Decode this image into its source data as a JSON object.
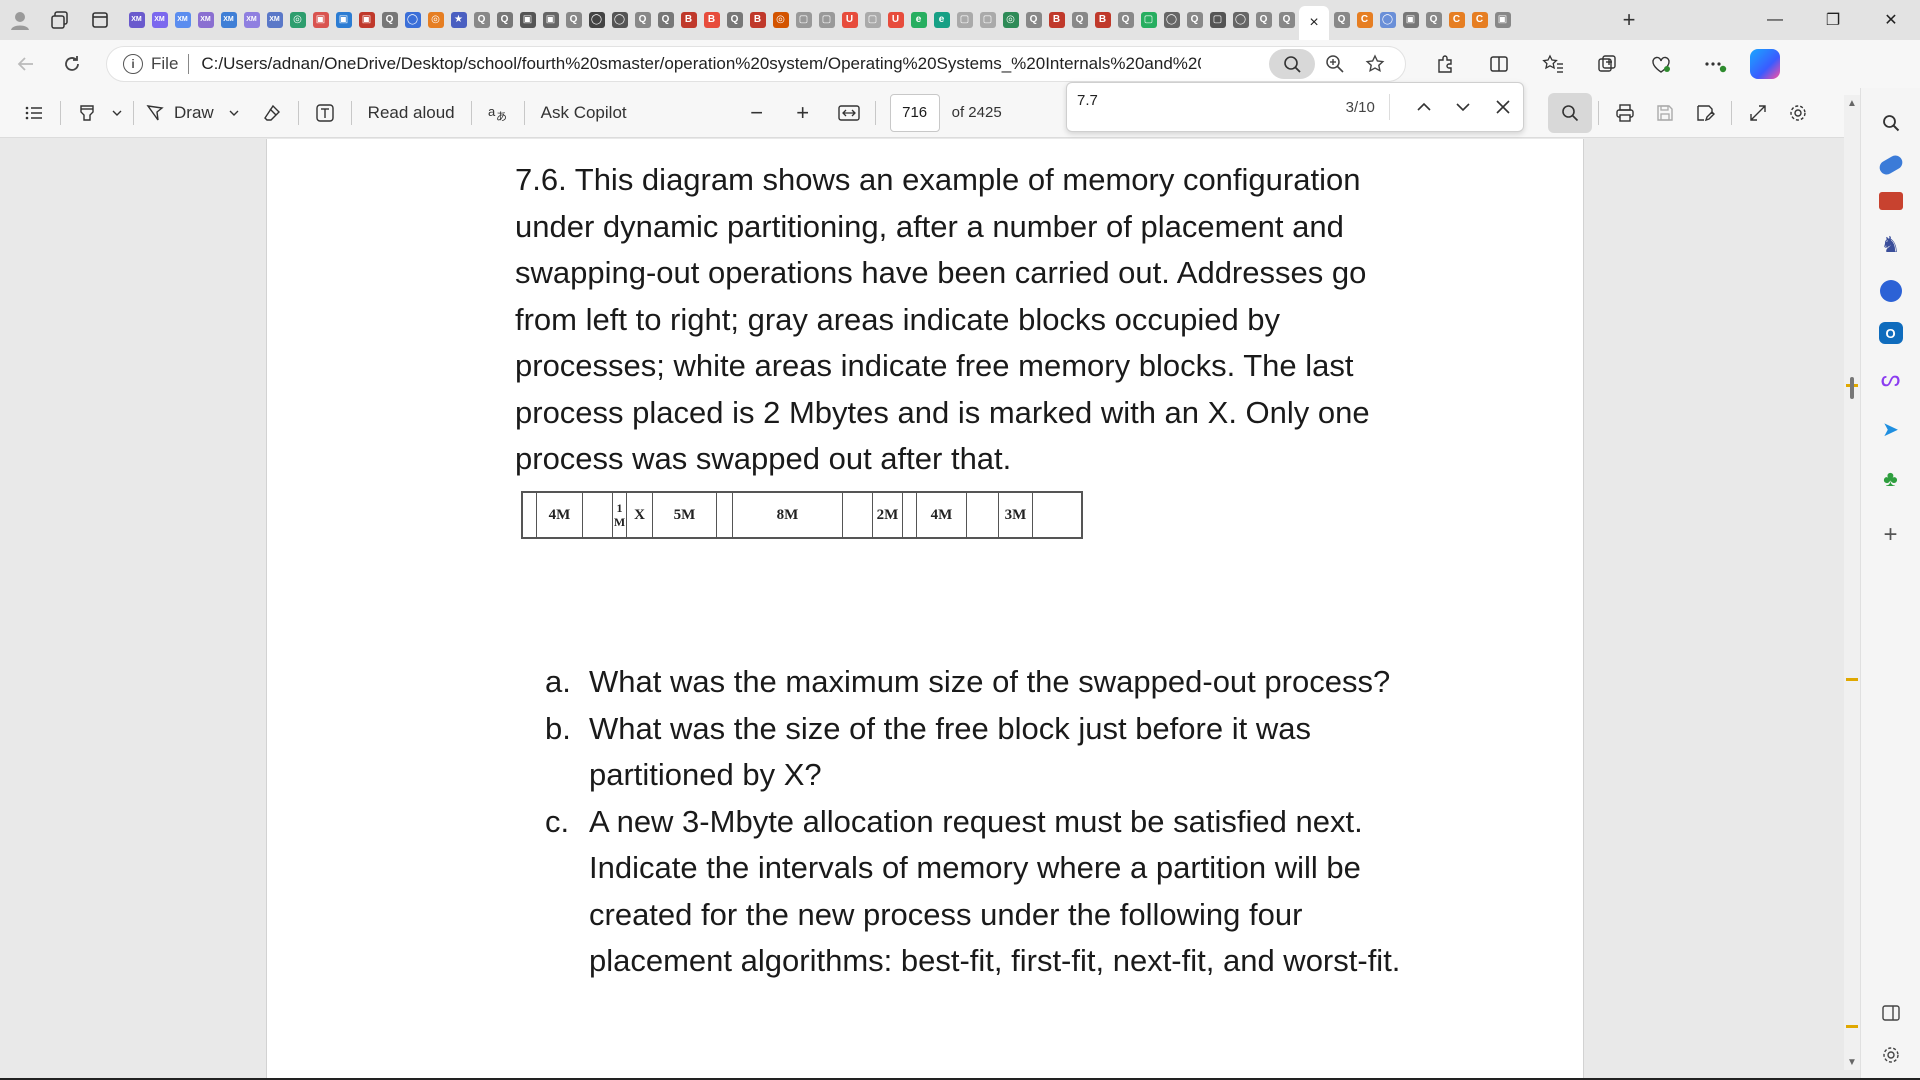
{
  "browser": {
    "tab_glyphs": [
      "XM",
      "XM",
      "XM",
      "XM",
      "XM",
      "XM",
      "XM",
      "◎",
      "▣",
      "▣",
      "▣",
      "Q",
      "◯",
      "◎",
      "★",
      "Q",
      "Q",
      "▣",
      "▣",
      "Q",
      "◯",
      "◯",
      "Q",
      "Q",
      "B",
      "B",
      "Q",
      "B",
      "◎",
      "▢",
      "▢",
      "U",
      "▢",
      "U",
      "e",
      "e",
      "▢",
      "▢",
      "◎",
      "Q",
      "B",
      "Q",
      "B",
      "Q",
      "▢",
      "◯",
      "Q",
      "▢",
      "◯",
      "Q",
      "Q"
    ],
    "tabs_right_glyphs": [
      "Q",
      "C",
      "◯",
      "▣",
      "Q",
      "C",
      "C",
      "▣"
    ],
    "active_tab_close": "×",
    "new_tab": "+",
    "window": {
      "minimize": "—",
      "restore": "❐",
      "close": "✕"
    }
  },
  "address_bar": {
    "scheme_label": "File",
    "url": "C:/Users/adnan/OneDrive/Desktop/school/fourth%20smaster/operation%20system/Operating%20Systems_%20Internals%20and%20Design%20..."
  },
  "pdf_toolbar": {
    "draw_label": "Draw",
    "read_aloud_label": "Read aloud",
    "ask_copilot_label": "Ask Copilot",
    "zoom_out": "−",
    "zoom_in": "+",
    "page_number": "716",
    "page_total": "of 2425"
  },
  "find": {
    "query": "7.7",
    "count": "3/10"
  },
  "document": {
    "paragraph": "7.6. This diagram shows an example of memory configuration under dynamic partitioning, after a number of placement and swapping-out operations have been carried out. Addresses go from left to right; gray areas indicate blocks occupied by processes; white areas indicate free memory blocks. The last process placed is 2 Mbytes and is marked with an X. Only one process was swapped out after that.",
    "diagram_labels": {
      "four_m_a": "4M",
      "one_m_top": "1",
      "one_m_bottom": "M",
      "x": "X",
      "five_m": "5M",
      "eight_m": "8M",
      "two_m": "2M",
      "four_m_b": "4M",
      "three_m": "3M"
    },
    "questions": [
      {
        "letter": "a.",
        "text": "What was the maximum size of the swapped-out process?"
      },
      {
        "letter": "b.",
        "text": "What was the size of the free block just before it was partitioned by X?"
      },
      {
        "letter": "c.",
        "text": "A new 3-Mbyte allocation request must be satisfied next. Indicate the intervals of memory where a partition will be created for the new process under the following four placement algorithms: best-fit, first-fit, next-fit, and worst-fit."
      }
    ]
  },
  "colors": {
    "accent": "#0a66c2",
    "find_highlight": "#e0a800"
  }
}
